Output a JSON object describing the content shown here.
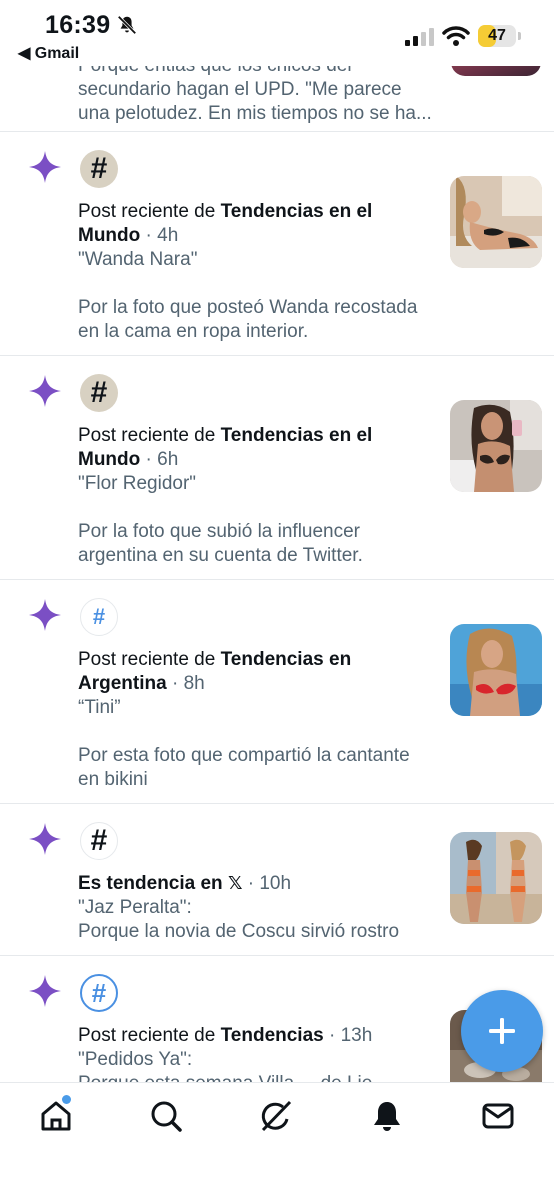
{
  "status": {
    "time": "16:39",
    "back_app": "Gmail",
    "battery": "47",
    "battery_level": 0.47
  },
  "previous": {
    "line1": "Porque entiás que los chicos del",
    "line2": "secundario hagan el UPD. \"Me parece",
    "line3": "una pelotudez. En mis tiempos no se ha..."
  },
  "items": [
    {
      "prefix": "Post reciente de ",
      "source_a": "Tendencias en el",
      "source_b": "Mundo",
      "time": " · 4h",
      "topic": "\"Wanda Nara\"",
      "desc1": "Por la foto que posteó Wanda recostada",
      "desc2": "en la cama en ropa interior."
    },
    {
      "prefix": "Post reciente de ",
      "source_a": "Tendencias en el",
      "source_b": "Mundo",
      "time": " · 6h",
      "topic": "\"Flor Regidor\"",
      "desc1": "Por la foto que subió la influencer",
      "desc2": "argentina en su cuenta de Twitter."
    },
    {
      "prefix": "Post reciente de ",
      "source_a": "Tendencias en",
      "source_b": "Argentina",
      "time": " · 8h",
      "topic": "“Tini”",
      "desc1": "Por esta foto que compartió la cantante",
      "desc2": "en bikini"
    },
    {
      "trend_label": "Es tendencia en ",
      "x_logo": "𝕏",
      "time": " · 10h",
      "topic": "\"Jaz Peralta\":",
      "desc1": "Porque la novia de Coscu sirvió rostro"
    },
    {
      "prefix": "Post reciente de ",
      "source_a": "Tendencias",
      "time": " · 13h",
      "topic": "\"Pedidos Ya\":",
      "desc1": "Porque esta semana Villa ... de Lie"
    }
  ],
  "icons": {
    "sparkle": "sparkle-icon",
    "hashtag": "#",
    "home": "home-icon",
    "search": "search-icon",
    "grok": "grok-icon",
    "notifications": "bell-icon",
    "messages": "mail-icon",
    "compose": "plus-icon"
  },
  "colors": {
    "sparkle": "#7b4fc4",
    "accent": "#4a9be8",
    "muted": "#536471",
    "battery": "#f5cc35"
  }
}
